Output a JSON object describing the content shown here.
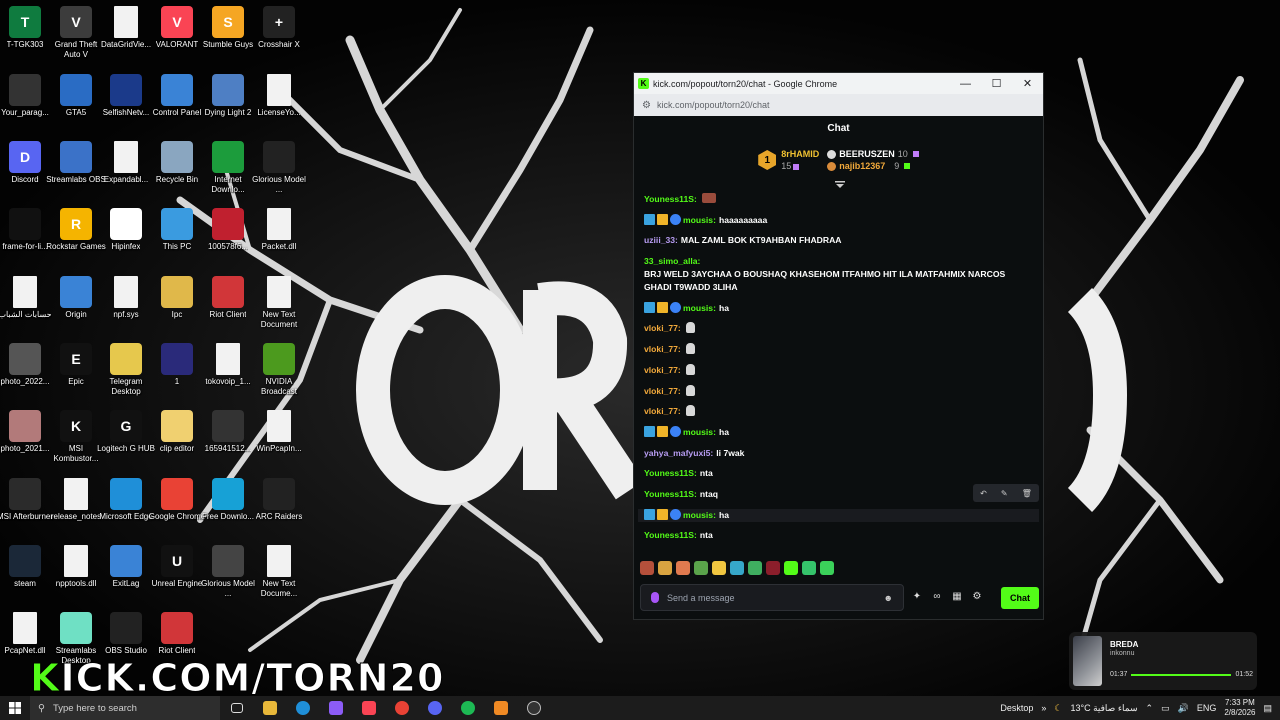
{
  "desktop": {
    "icons": [
      {
        "label": "T-TGK303",
        "color": "#0f7b3f",
        "glyph": "T"
      },
      {
        "label": "Grand Theft Auto V",
        "color": "#3c3c3c",
        "glyph": "V"
      },
      {
        "label": "DataGridVie...",
        "color": "file",
        "glyph": ""
      },
      {
        "label": "VALORANT",
        "color": "#fa4454",
        "glyph": "V"
      },
      {
        "label": "Stumble Guys",
        "color": "#f5a623",
        "glyph": "S"
      },
      {
        "label": "Crosshair X",
        "color": "#222",
        "glyph": "+"
      },
      {
        "label": "Your_parag...",
        "color": "#333",
        "glyph": ""
      },
      {
        "label": "GTA5",
        "color": "#2a6cc4",
        "glyph": ""
      },
      {
        "label": "SelfishNetv...",
        "color": "#1b3a8a",
        "glyph": ""
      },
      {
        "label": "Control Panel",
        "color": "#3a83d6",
        "glyph": ""
      },
      {
        "label": "Dying Light 2",
        "color": "#4e7fc4",
        "glyph": ""
      },
      {
        "label": "LicenseYo...",
        "color": "file",
        "glyph": ""
      },
      {
        "label": "Discord",
        "color": "#5865f2",
        "glyph": "D"
      },
      {
        "label": "Streamlabs OBS",
        "color": "#3b72c8",
        "glyph": ""
      },
      {
        "label": "Expandabl...",
        "color": "file",
        "glyph": ""
      },
      {
        "label": "Recycle Bin",
        "color": "#8aa6c0",
        "glyph": ""
      },
      {
        "label": "Internet Downlo...",
        "color": "#1c9c3c",
        "glyph": ""
      },
      {
        "label": "Glorious Model ...",
        "color": "#222",
        "glyph": ""
      },
      {
        "label": "frame-for-li...",
        "color": "#111",
        "glyph": ""
      },
      {
        "label": "Rockstar Games",
        "color": "#f5b400",
        "glyph": "R"
      },
      {
        "label": "Hipinfex",
        "color": "#ffffff",
        "glyph": ""
      },
      {
        "label": "This PC",
        "color": "#3a9be0",
        "glyph": ""
      },
      {
        "label": "100578f6...",
        "color": "#c0202f",
        "glyph": ""
      },
      {
        "label": "Packet.dll",
        "color": "file",
        "glyph": ""
      },
      {
        "label": "حسابات الشباب",
        "color": "file",
        "glyph": ""
      },
      {
        "label": "Origin",
        "color": "#3a83d6",
        "glyph": ""
      },
      {
        "label": "npf.sys",
        "color": "file",
        "glyph": ""
      },
      {
        "label": "Ipc",
        "color": "#e0b84a",
        "glyph": ""
      },
      {
        "label": "Riot Client",
        "color": "#d13639",
        "glyph": ""
      },
      {
        "label": "New Text Document",
        "color": "file",
        "glyph": ""
      },
      {
        "label": "photo_2022...",
        "color": "#555",
        "glyph": ""
      },
      {
        "label": "Epic",
        "color": "#111",
        "glyph": "E"
      },
      {
        "label": "Telegram Desktop",
        "color": "#e6c84d",
        "glyph": ""
      },
      {
        "label": "1",
        "color": "#2a2a7a",
        "glyph": ""
      },
      {
        "label": "tokovoip_1...",
        "color": "file",
        "glyph": ""
      },
      {
        "label": "NVIDIA Broadcast",
        "color": "#4c9a1e",
        "glyph": ""
      },
      {
        "label": "photo_2021...",
        "color": "#b27a7a",
        "glyph": ""
      },
      {
        "label": "MSI Kombustor...",
        "color": "#111",
        "glyph": "K"
      },
      {
        "label": "Logitech G HUB",
        "color": "#111",
        "glyph": "G"
      },
      {
        "label": "clip editor",
        "color": "#f0d070",
        "glyph": ""
      },
      {
        "label": "165941512...",
        "color": "#333",
        "glyph": ""
      },
      {
        "label": "WinPcapIn...",
        "color": "file",
        "glyph": ""
      },
      {
        "label": "MSI Afterburner",
        "color": "#2b2b2b",
        "glyph": ""
      },
      {
        "label": "release_notes",
        "color": "file",
        "glyph": ""
      },
      {
        "label": "Microsoft Edge",
        "color": "#1f8fd8",
        "glyph": ""
      },
      {
        "label": "Google Chrome",
        "color": "#e94235",
        "glyph": ""
      },
      {
        "label": "Free Downlo...",
        "color": "#17a1d6",
        "glyph": ""
      },
      {
        "label": "ARC Raiders",
        "color": "#222",
        "glyph": ""
      },
      {
        "label": "steam",
        "color": "#1b2838",
        "glyph": ""
      },
      {
        "label": "npptools.dll",
        "color": "file",
        "glyph": ""
      },
      {
        "label": "ExitLag",
        "color": "#3a83d6",
        "glyph": ""
      },
      {
        "label": "Unreal Engine",
        "color": "#111",
        "glyph": "U"
      },
      {
        "label": "Glorious Model ...",
        "color": "#444",
        "glyph": ""
      },
      {
        "label": "New Text Docume...",
        "color": "file",
        "glyph": ""
      },
      {
        "label": "PcapNet.dll",
        "color": "file",
        "glyph": ""
      },
      {
        "label": "Streamlabs Desktop",
        "color": "#6fe0c4",
        "glyph": ""
      },
      {
        "label": "OBS Studio",
        "color": "#222",
        "glyph": ""
      },
      {
        "label": "Riot Client",
        "color": "#d13639",
        "glyph": ""
      }
    ]
  },
  "overlay": {
    "kick_url": "ICK.COM/TORN20",
    "kick_k": "K"
  },
  "browser": {
    "window_title": "kick.com/popout/torn20/chat - Google Chrome",
    "url": "kick.com/popout/torn20/chat"
  },
  "chat": {
    "header": "Chat",
    "leaderboard": {
      "first": {
        "rank": "1",
        "name": "8rHAMID",
        "count": "15"
      },
      "second": {
        "name": "BEERUSZEN",
        "count": "10"
      },
      "third": {
        "name": "najib12367",
        "count": "9"
      }
    },
    "messages": [
      {
        "user": "Youness11S",
        "color": "#53fc18",
        "text": "",
        "badges": 0,
        "emotes": 1
      },
      {
        "user": "mousis",
        "color": "#53fc18",
        "text": "haaaaaaaaa",
        "badges": 3,
        "emotes": 0
      },
      {
        "user": "uziii_33",
        "color": "#b79cf2",
        "text": "MAL ZAML BOK KT9AHBAN FHADRAA",
        "badges": 0,
        "emotes": 0
      },
      {
        "user": "33_simo_alla",
        "color": "#53fc18",
        "text": "BRJ WELD 3AYCHAA O BOUSHAQ KHASEHOM ITFAHMO HIT ILA MATFAHMIX NARCOS GHADI T9WADD 3LIHA",
        "badges": 0,
        "emotes": 0
      },
      {
        "user": "mousis",
        "color": "#53fc18",
        "text": "ha",
        "badges": 3,
        "emotes": 0
      },
      {
        "user": "vloki_77",
        "color": "#f2a93b",
        "text": "",
        "badges": 0,
        "emotes": 1
      },
      {
        "user": "vloki_77",
        "color": "#f2a93b",
        "text": "",
        "badges": 0,
        "emotes": 1
      },
      {
        "user": "vloki_77",
        "color": "#f2a93b",
        "text": "",
        "badges": 0,
        "emotes": 1
      },
      {
        "user": "vloki_77",
        "color": "#f2a93b",
        "text": "",
        "badges": 0,
        "emotes": 1
      },
      {
        "user": "vloki_77",
        "color": "#f2a93b",
        "text": "",
        "badges": 0,
        "emotes": 1
      },
      {
        "user": "mousis",
        "color": "#53fc18",
        "text": "ha",
        "badges": 3,
        "emotes": 0
      },
      {
        "user": "yahya_mafyuxi5",
        "color": "#b79cf2",
        "text": "li 7wak",
        "badges": 0,
        "emotes": 0
      },
      {
        "user": "Youness11S",
        "color": "#53fc18",
        "text": "nta",
        "badges": 0,
        "emotes": 0
      },
      {
        "user": "Youness11S",
        "color": "#53fc18",
        "text": "ntaq",
        "badges": 0,
        "emotes": 0
      },
      {
        "user": "mousis",
        "color": "#53fc18",
        "text": "ha",
        "badges": 3,
        "emotes": 0
      },
      {
        "user": "Youness11S",
        "color": "#53fc18",
        "text": "nta",
        "badges": 0,
        "emotes": 0
      },
      {
        "user": "uziii_33",
        "color": "#b79cf2",
        "text": "MAL ZAML BOK KT9AHBAN FHADRAA",
        "badges": 0,
        "emotes": 0
      }
    ],
    "input_placeholder": "Send a message",
    "send_label": "Chat"
  },
  "media": {
    "song": "BREDA",
    "artist": "inkonnu",
    "elapsed": "01:37",
    "total": "01:52"
  },
  "taskbar": {
    "search_placeholder": "Type here to search",
    "desktop_label": "Desktop",
    "weather": "13°C سماء صافية",
    "lang": "ENG",
    "time": "7:33 PM",
    "date": "2/8/2026"
  }
}
